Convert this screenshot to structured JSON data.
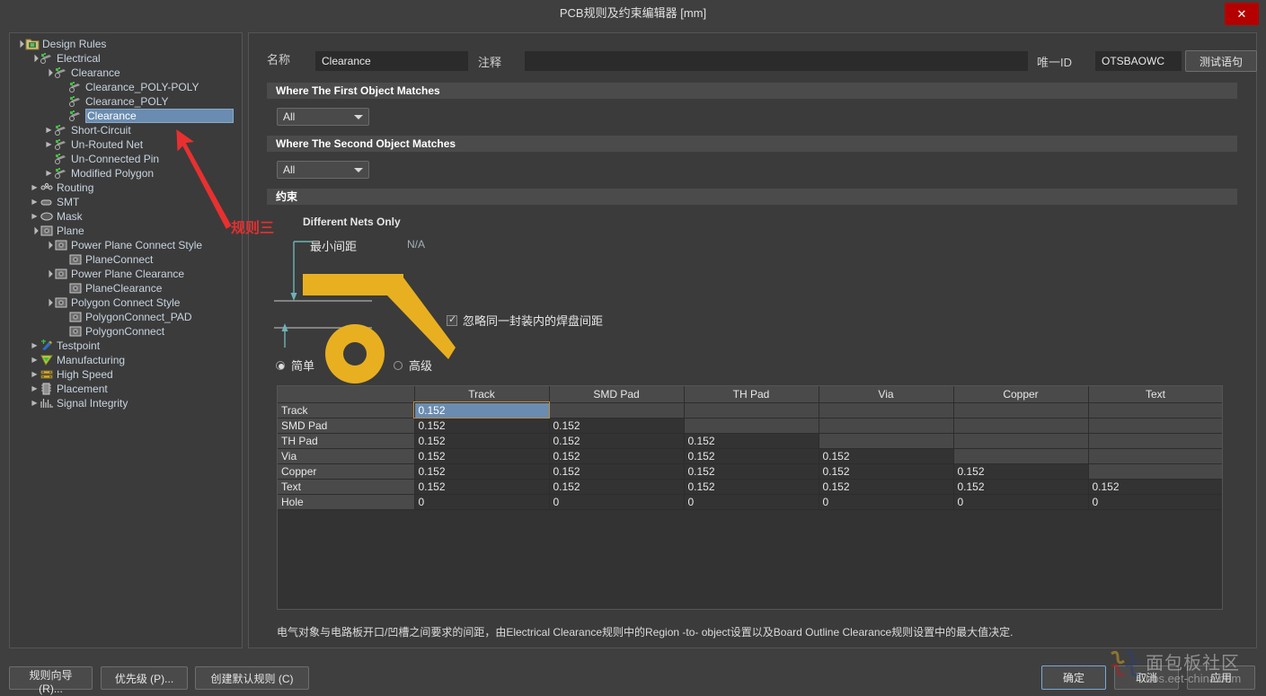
{
  "window": {
    "title": "PCB规则及约束编辑器 [mm]",
    "close_label": "✕"
  },
  "tree": {
    "root_label": "Design Rules",
    "items": [
      {
        "label": "Design Rules",
        "depth": 0,
        "arrow": "expanded",
        "icon": "folder-rules-icon",
        "selected": false
      },
      {
        "label": "Electrical",
        "depth": 1,
        "arrow": "expanded",
        "icon": "electrical-icon",
        "selected": false
      },
      {
        "label": "Clearance",
        "depth": 2,
        "arrow": "expanded",
        "icon": "electrical-icon",
        "selected": false
      },
      {
        "label": "Clearance_POLY-POLY",
        "depth": 3,
        "arrow": "none",
        "icon": "electrical-icon",
        "selected": false
      },
      {
        "label": "Clearance_POLY",
        "depth": 3,
        "arrow": "none",
        "icon": "electrical-icon",
        "selected": false
      },
      {
        "label": "Clearance",
        "depth": 3,
        "arrow": "none",
        "icon": "electrical-icon",
        "selected": true
      },
      {
        "label": "Short-Circuit",
        "depth": 2,
        "arrow": "collapsed",
        "icon": "electrical-icon",
        "selected": false
      },
      {
        "label": "Un-Routed Net",
        "depth": 2,
        "arrow": "collapsed",
        "icon": "electrical-icon",
        "selected": false
      },
      {
        "label": "Un-Connected Pin",
        "depth": 2,
        "arrow": "none",
        "icon": "electrical-icon",
        "selected": false
      },
      {
        "label": "Modified Polygon",
        "depth": 2,
        "arrow": "collapsed",
        "icon": "electrical-icon",
        "selected": false
      },
      {
        "label": "Routing",
        "depth": 1,
        "arrow": "collapsed",
        "icon": "routing-icon",
        "selected": false
      },
      {
        "label": "SMT",
        "depth": 1,
        "arrow": "collapsed",
        "icon": "smt-icon",
        "selected": false
      },
      {
        "label": "Mask",
        "depth": 1,
        "arrow": "collapsed",
        "icon": "mask-icon",
        "selected": false
      },
      {
        "label": "Plane",
        "depth": 1,
        "arrow": "expanded",
        "icon": "plane-icon",
        "selected": false
      },
      {
        "label": "Power Plane Connect Style",
        "depth": 2,
        "arrow": "expanded",
        "icon": "plane-icon",
        "selected": false
      },
      {
        "label": "PlaneConnect",
        "depth": 3,
        "arrow": "none",
        "icon": "plane-icon",
        "selected": false
      },
      {
        "label": "Power Plane Clearance",
        "depth": 2,
        "arrow": "expanded",
        "icon": "plane-icon",
        "selected": false
      },
      {
        "label": "PlaneClearance",
        "depth": 3,
        "arrow": "none",
        "icon": "plane-icon",
        "selected": false
      },
      {
        "label": "Polygon Connect Style",
        "depth": 2,
        "arrow": "expanded",
        "icon": "plane-icon",
        "selected": false
      },
      {
        "label": "PolygonConnect_PAD",
        "depth": 3,
        "arrow": "none",
        "icon": "plane-icon",
        "selected": false
      },
      {
        "label": "PolygonConnect",
        "depth": 3,
        "arrow": "none",
        "icon": "plane-icon",
        "selected": false
      },
      {
        "label": "Testpoint",
        "depth": 1,
        "arrow": "collapsed",
        "icon": "testpoint-icon",
        "selected": false
      },
      {
        "label": "Manufacturing",
        "depth": 1,
        "arrow": "collapsed",
        "icon": "manufacturing-icon",
        "selected": false
      },
      {
        "label": "High Speed",
        "depth": 1,
        "arrow": "collapsed",
        "icon": "high-speed-icon",
        "selected": false
      },
      {
        "label": "Placement",
        "depth": 1,
        "arrow": "collapsed",
        "icon": "placement-icon",
        "selected": false
      },
      {
        "label": "Signal Integrity",
        "depth": 1,
        "arrow": "collapsed",
        "icon": "signal-integrity-icon",
        "selected": false
      }
    ]
  },
  "form": {
    "name_label": "名称",
    "name_value": "Clearance",
    "comment_label": "注释",
    "comment_value": "",
    "comment_placeholder": "",
    "uid_label": "唯一ID",
    "uid_value": "OTSBAOWC",
    "test_button": "测试语句"
  },
  "sections": {
    "first_object": {
      "header": "Where The First Object Matches",
      "scope_value": "All"
    },
    "second_object": {
      "header": "Where The Second Object Matches",
      "scope_value": "All"
    },
    "constraint": {
      "header": "约束",
      "different_nets_only": "Different Nets Only",
      "min_clearance_label": "最小间距",
      "min_clearance_value": "N/A",
      "ignore_pad_label": "忽略同一封装内的焊盘间距",
      "ignore_pad_checked": true,
      "mode_simple": "简单",
      "mode_advanced": "高级",
      "mode_selected": "简单",
      "annotation_red": "规则三"
    }
  },
  "matrix": {
    "columns": [
      "",
      "Track",
      "SMD Pad",
      "TH Pad",
      "Via",
      "Copper",
      "Text"
    ],
    "rows": [
      {
        "header": "Track",
        "values": [
          "0.152",
          "",
          "",
          "",
          "",
          ""
        ]
      },
      {
        "header": "SMD Pad",
        "values": [
          "0.152",
          "0.152",
          "",
          "",
          "",
          ""
        ]
      },
      {
        "header": "TH Pad",
        "values": [
          "0.152",
          "0.152",
          "0.152",
          "",
          "",
          ""
        ]
      },
      {
        "header": "Via",
        "values": [
          "0.152",
          "0.152",
          "0.152",
          "0.152",
          "",
          ""
        ]
      },
      {
        "header": "Copper",
        "values": [
          "0.152",
          "0.152",
          "0.152",
          "0.152",
          "0.152",
          ""
        ]
      },
      {
        "header": "Text",
        "values": [
          "0.152",
          "0.152",
          "0.152",
          "0.152",
          "0.152",
          "0.152"
        ]
      },
      {
        "header": "Hole",
        "values": [
          "0",
          "0",
          "0",
          "0",
          "0",
          "0"
        ]
      }
    ],
    "active_cell": {
      "row": 0,
      "col": 0
    }
  },
  "status": {
    "text": "电气对象与电路板开口/凹槽之间要求的间距，由Electrical Clearance规则中的Region -to- object设置以及Board Outline Clearance规则设置中的最大值决定."
  },
  "footer": {
    "rule_wizard": "规则向导 (R)...",
    "priority": "优先级 (P)...",
    "create_default": "创建默认规则 (C)",
    "ok": "确定",
    "cancel": "取消",
    "apply": "应用"
  },
  "watermark": {
    "name": "面包板社区",
    "url": "bbs.eet-china.com"
  },
  "colors": {
    "accent_blue": "#6a8cb0",
    "close_red": "#b50000",
    "illus_yellow": "#e8b020",
    "annotation_red": "#e03030",
    "panel_bg": "#3b3b3b",
    "window_bg": "#3f3f3f"
  }
}
